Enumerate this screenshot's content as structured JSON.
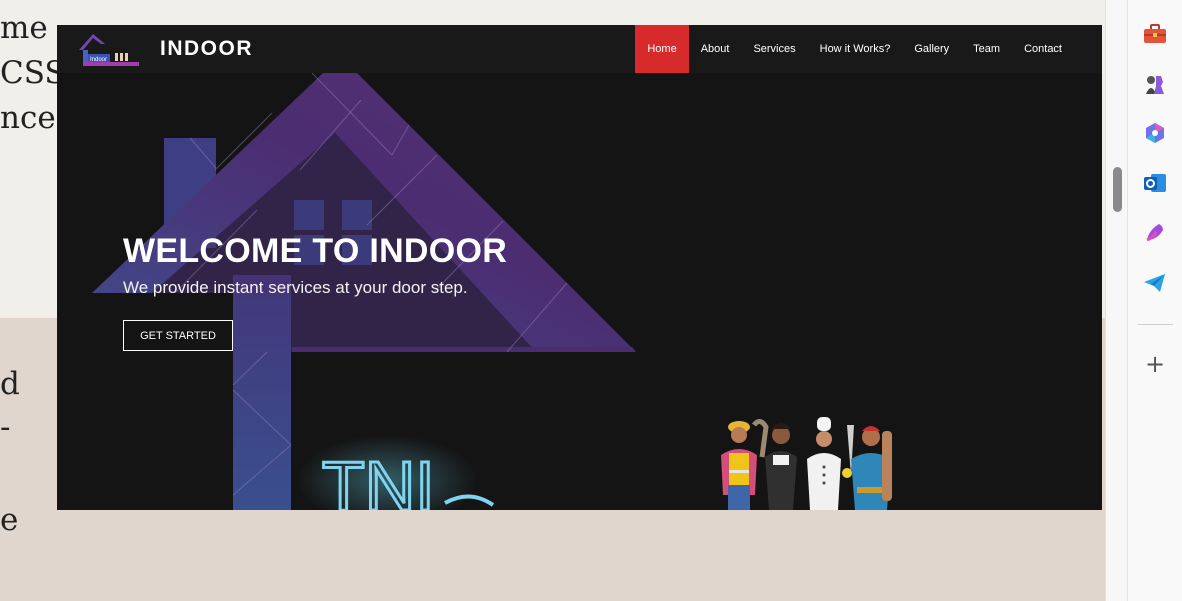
{
  "background_page": {
    "top_lines": [
      "me",
      "CSS,",
      "nce"
    ],
    "bottom_lines": [
      "d",
      "-",
      "e"
    ]
  },
  "site": {
    "brand": "INDOOR",
    "logo_text": "Indoor",
    "nav": [
      "Home",
      "About",
      "Services",
      "How it Works?",
      "Gallery",
      "Team",
      "Contact"
    ],
    "active_nav": "Home",
    "hero": {
      "title": "WELCOME TO INDOOR",
      "subtitle": "We provide instant services at your door step.",
      "button": "GET STARTED",
      "neon_sign": "TNI"
    },
    "colors": {
      "accent": "#d72b2b",
      "house_purple": "#4b2b73",
      "house_blue": "#3d4f8e",
      "background": "#141414"
    }
  },
  "sidebar": {
    "icons": [
      "toolbox-icon",
      "chess-pieces-icon",
      "copilot-icon",
      "outlook-icon",
      "designer-icon",
      "telegram-send-icon"
    ],
    "add_label": "+"
  }
}
